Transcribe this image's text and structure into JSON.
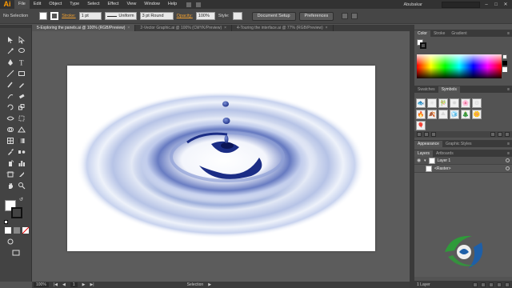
{
  "app": {
    "logo": "Ai"
  },
  "menu": {
    "items": [
      "File",
      "Edit",
      "Object",
      "Type",
      "Select",
      "Effect",
      "View",
      "Window",
      "Help"
    ],
    "user": "Abubakar",
    "window_controls": [
      "–",
      "□",
      "✕"
    ]
  },
  "control_bar": {
    "selection_label": "No Selection",
    "stroke_label": "Stroke:",
    "stroke_weight": "1 pt",
    "stroke_profile": "Uniform",
    "brush": "3 pt Round",
    "opacity_label": "Opacity:",
    "opacity_value": "100%",
    "style_label": "Style:",
    "document_setup": "Document Setup",
    "preferences": "Preferences"
  },
  "tabs": [
    {
      "label": "5-Exploring the panels.ai @ 100% (RGB/Preview)",
      "active": true
    },
    {
      "label": "2-Vector Graphic.ai @ 100% (CMYK/Preview)",
      "active": false
    },
    {
      "label": "4-Touring the interface.ai @ 77% (RGB/Preview)",
      "active": false
    }
  ],
  "status": {
    "zoom": "100%",
    "page": "1",
    "mode": "Selection"
  },
  "panels": {
    "color_tabs": [
      "Color",
      "Stroke",
      "Gradient"
    ],
    "symbols_tabs": [
      "Swatches",
      "Symbols"
    ],
    "appearance_tabs": [
      "Appearance",
      "Graphic Styles"
    ],
    "layers_tabs": [
      "Layers",
      "Artboards"
    ],
    "layer_name": "Layer 1",
    "sublayer_name": "<Raster>",
    "footer_label": "1 Layer"
  },
  "symbols": [
    "🐟",
    "✳",
    "🎋",
    "✸",
    "🌸",
    "⚙",
    "🔥",
    "🍂",
    "⛰",
    "🧊",
    "🎄",
    "🌼",
    "🎈",
    "",
    "",
    "",
    "",
    ""
  ],
  "colors": {
    "accent": "#f0a030",
    "logo": "#ff9a00",
    "ripple_dark": "#1b2d85",
    "ripple_light": "#c8d2ee"
  }
}
